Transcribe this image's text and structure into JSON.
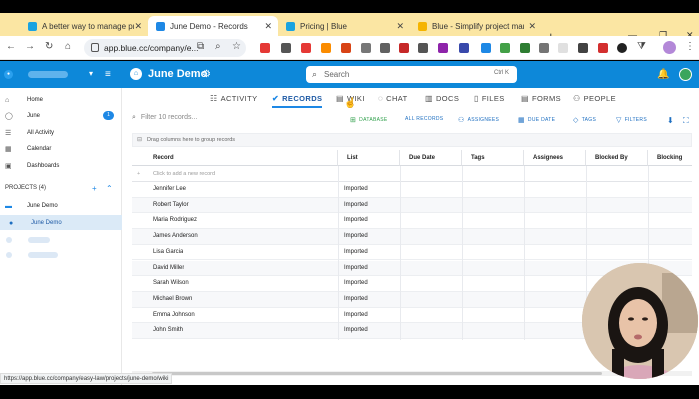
{
  "browser": {
    "tabs": [
      {
        "title": "A better way to manage projec",
        "favicon_color": "#1aa3e0"
      },
      {
        "title": "June Demo - Records",
        "favicon_color": "#1e88e5"
      },
      {
        "title": "Pricing | Blue",
        "favicon_color": "#1aa3e0"
      },
      {
        "title": "Blue - Simplify project manage",
        "favicon_color": "#f5b400"
      }
    ],
    "url": "app.blue.cc/company/e...",
    "status_url": "https://app.blue.cc/company/easy-law/projects/june-demo/wiki"
  },
  "app": {
    "project_title": "June Demo",
    "search_placeholder": "Search",
    "search_shortcut": "Ctrl K",
    "accent": "#0d88d9"
  },
  "sidebar": {
    "items": [
      {
        "label": "Home",
        "icon": "home-icon"
      },
      {
        "label": "June",
        "icon": "check-circle-icon",
        "badge": "1"
      },
      {
        "label": "All Activity",
        "icon": "activity-icon"
      },
      {
        "label": "Calendar",
        "icon": "calendar-icon"
      },
      {
        "label": "Dashboards",
        "icon": "dashboard-icon"
      }
    ],
    "projects_label": "PROJECTS (4)",
    "project_group": "June Demo",
    "active_project": "June Demo"
  },
  "nav_tabs": [
    "ACTIVITY",
    "RECORDS",
    "WIKI",
    "CHAT",
    "DOCS",
    "FILES",
    "FORMS",
    "PEOPLE"
  ],
  "active_tab": "RECORDS",
  "toolbar": {
    "filter_placeholder": "Filter 10 records...",
    "actions": [
      "DATABASE",
      "ALL RECORDS",
      "ASSIGNEES",
      "DUE DATE",
      "TAGS",
      "FILTERS"
    ]
  },
  "group_hint": "Drag columns here to group records",
  "table": {
    "columns": [
      "Record",
      "List",
      "Due Date",
      "Tags",
      "Assignees",
      "Blocked By",
      "Blocking"
    ],
    "add_placeholder": "Click to add a new record",
    "rows": [
      {
        "record": "Jennifer Lee",
        "list": "Imported"
      },
      {
        "record": "Robert Taylor",
        "list": "Imported"
      },
      {
        "record": "Maria Rodriguez",
        "list": "Imported"
      },
      {
        "record": "James Anderson",
        "list": "Imported"
      },
      {
        "record": "Lisa Garcia",
        "list": "Imported"
      },
      {
        "record": "David Miller",
        "list": "Imported"
      },
      {
        "record": "Sarah Wilson",
        "list": "Imported"
      },
      {
        "record": "Michael Brown",
        "list": "Imported"
      },
      {
        "record": "Emma Johnson",
        "list": "Imported"
      },
      {
        "record": "John Smith",
        "list": "Imported"
      }
    ]
  }
}
